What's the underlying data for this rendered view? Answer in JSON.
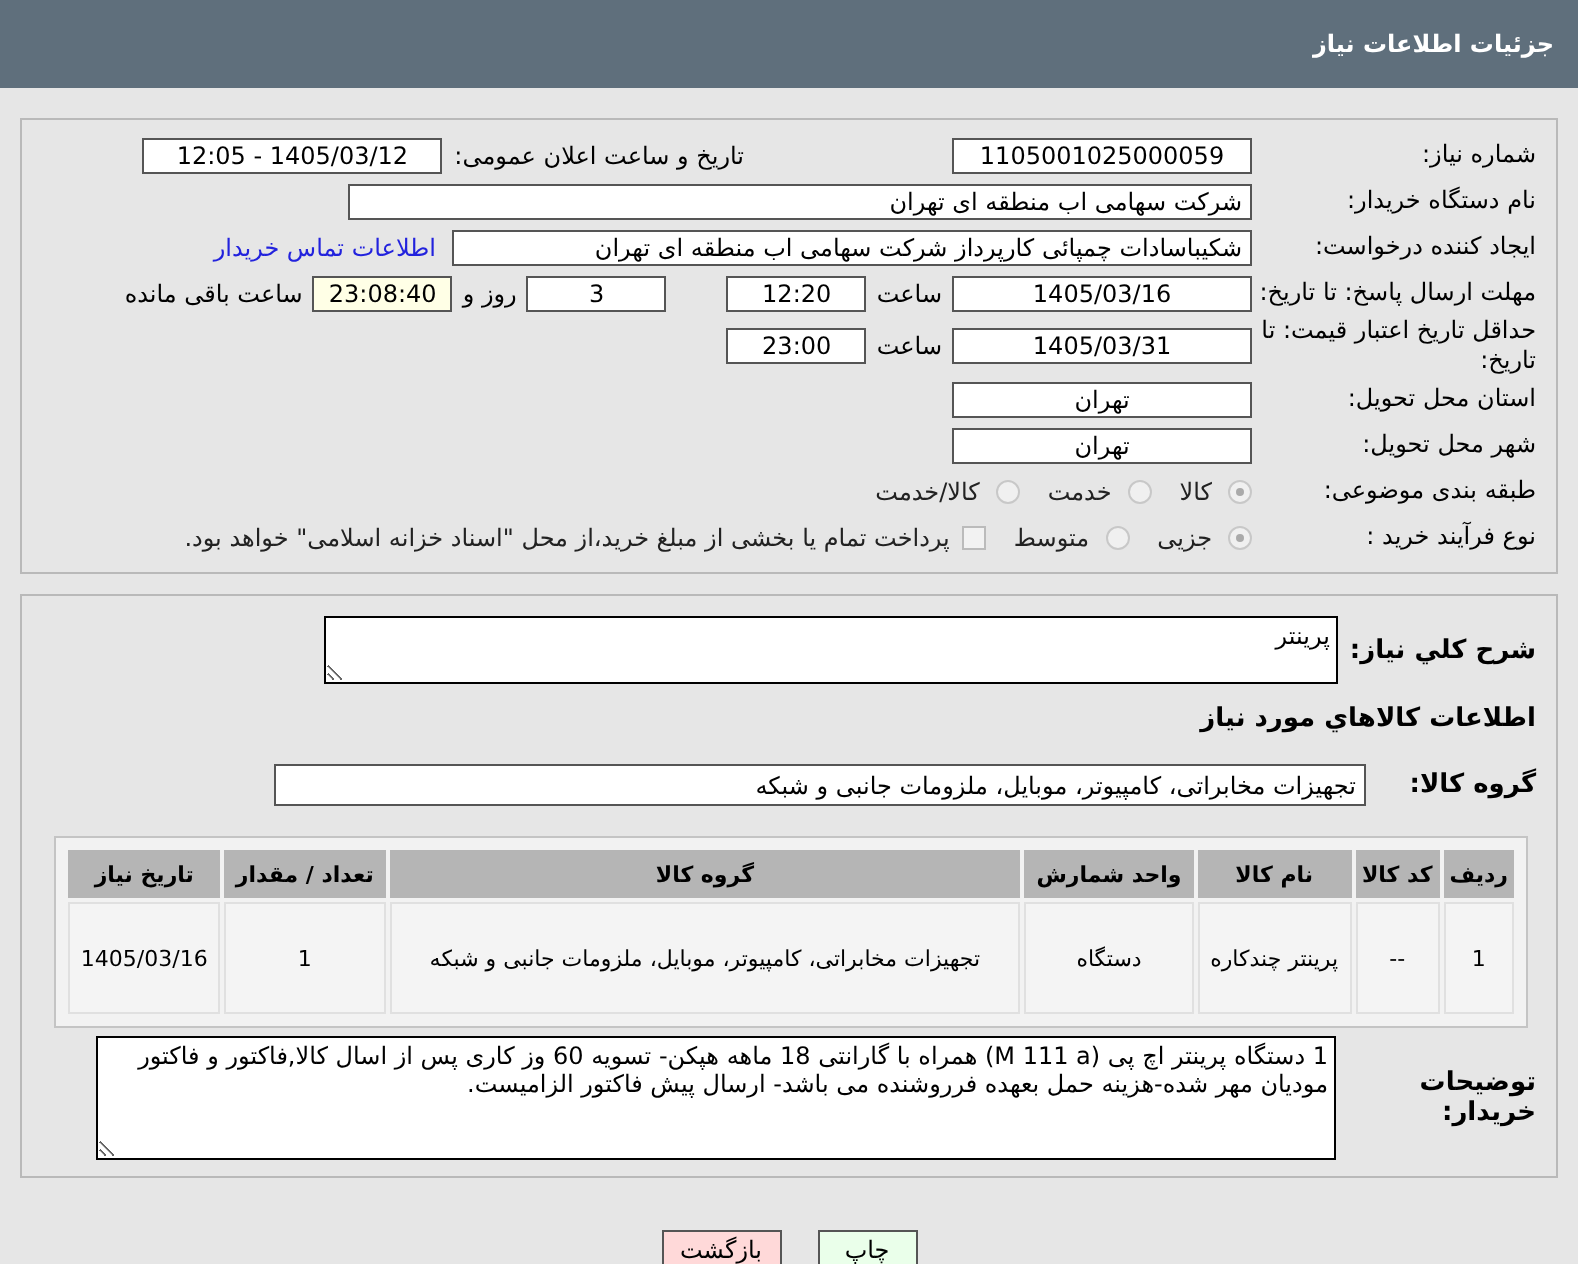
{
  "header": {
    "title": "جزئیات اطلاعات نیاز"
  },
  "details": [
    {
      "label": "شماره نیاز:",
      "items": [
        {
          "kind": "field",
          "value": "1105001025000059"
        },
        {
          "kind": "label",
          "text": "تاریخ و ساعت اعلان عمومی:"
        },
        {
          "kind": "field",
          "value": "1405/03/12 - 12:05"
        }
      ]
    },
    {
      "label": "نام دستگاه خریدار:",
      "items": [
        {
          "kind": "wide-field",
          "value": "شرکت سهامی اب منطقه ای تهران"
        }
      ]
    },
    {
      "label": "ایجاد کننده درخواست:",
      "items": [
        {
          "kind": "wide-field",
          "value": "شکیباسادات چمپائی کارپرداز شرکت سهامی اب منطقه ای تهران"
        },
        {
          "kind": "link",
          "text": "اطلاعات تماس خریدار"
        }
      ]
    },
    {
      "label": "مهلت ارسال پاسخ: تا تاریخ:",
      "items": [
        {
          "kind": "field",
          "value": "1405/03/16"
        },
        {
          "kind": "unit",
          "text": "ساعت"
        },
        {
          "kind": "small-field",
          "value": "12:20",
          "highlight": false
        },
        {
          "kind": "small-field",
          "value": "3",
          "highlight": false
        },
        {
          "kind": "unit",
          "text": "روز و"
        },
        {
          "kind": "small-field",
          "value": "23:08:40",
          "highlight": true
        },
        {
          "kind": "unit",
          "text": "ساعت باقی مانده"
        }
      ]
    },
    {
      "label": "حداقل تاریخ اعتبار قیمت: تا تاریخ:",
      "items": [
        {
          "kind": "field",
          "value": "1405/03/31"
        },
        {
          "kind": "unit",
          "text": "ساعت"
        },
        {
          "kind": "small-field",
          "value": "23:00",
          "highlight": false
        }
      ]
    },
    {
      "label": "استان محل تحویل:",
      "items": [
        {
          "kind": "field",
          "value": "تهران"
        }
      ]
    },
    {
      "label": "شهر محل تحویل:",
      "items": [
        {
          "kind": "field",
          "value": "تهران"
        }
      ]
    },
    {
      "label": "طبقه بندی موضوعی:",
      "items": [
        {
          "kind": "radio",
          "text": "کالا",
          "selected": true
        },
        {
          "kind": "radio",
          "text": "خدمت",
          "selected": false
        },
        {
          "kind": "radio",
          "text": "کالا/خدمت",
          "selected": false
        }
      ]
    },
    {
      "label": "نوع فرآیند خرید :",
      "items": [
        {
          "kind": "radio",
          "text": "جزیی",
          "selected": true
        },
        {
          "kind": "radio",
          "text": "متوسط",
          "selected": false
        },
        {
          "kind": "checkbox",
          "text": "پرداخت تمام یا بخشی از مبلغ خرید،از محل \"اسناد خزانه اسلامی\" خواهد بود.",
          "checked": false
        }
      ]
    }
  ],
  "summary": {
    "label": "شرح کلي نياز:",
    "value": "پرینتر"
  },
  "goods_heading": "اطلاعات کالاهاي مورد نياز",
  "goods_group": {
    "label": "گروه کالا:",
    "value": "تجهیزات مخابراتی، کامپیوتر، موبایل، ملزومات جانبی و شبکه"
  },
  "table": {
    "columns": [
      "ردیف",
      "کد کالا",
      "نام کالا",
      "واحد شمارش",
      "گروه کالا",
      "تعداد / مقدار",
      "تاریخ نیاز"
    ],
    "rows": [
      [
        "1",
        "--",
        "پرینتر چندکاره",
        "دستگاه",
        "تجهیزات مخابراتی، کامپیوتر، موبایل، ملزومات جانبی و شبکه",
        "1",
        "1405/03/16"
      ]
    ]
  },
  "buyer_notes": {
    "label": "توضیحات خریدار:",
    "value": "1 دستگاه پرینتر اچ پی (M 111 a) همراه با گارانتی 18 ماهه هپکن- تسویه 60 وز کاری پس از اسال کالا,فاکتور و فاکتور مودیان مهر شده-هزینه حمل بعهده فرروشنده می باشد- ارسال پیش فاکتور الزامیست."
  },
  "buttons": [
    {
      "kind": "print",
      "label": "چاپ"
    },
    {
      "kind": "back",
      "label": "بازگشت"
    }
  ]
}
